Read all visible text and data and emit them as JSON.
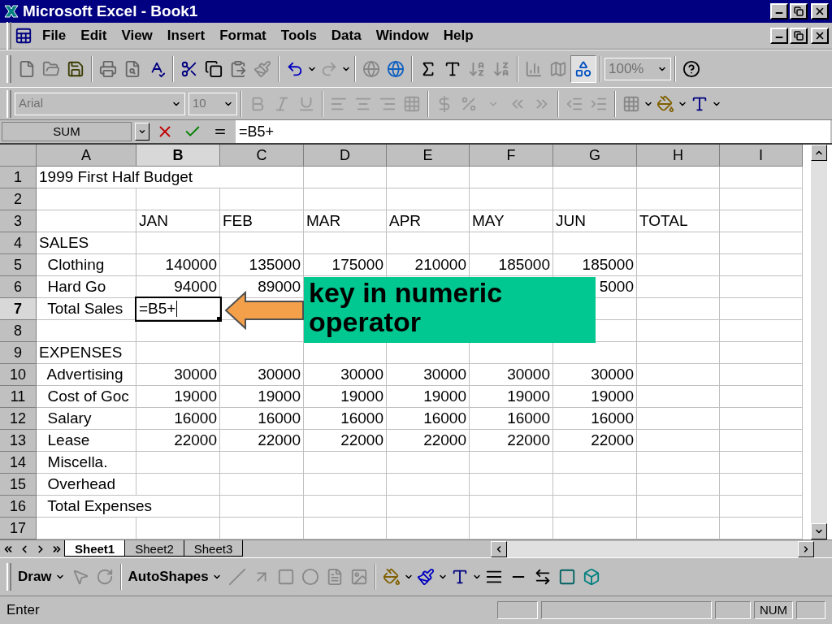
{
  "window": {
    "title": "Microsoft Excel - Book1"
  },
  "menu": [
    "File",
    "Edit",
    "View",
    "Insert",
    "Format",
    "Tools",
    "Data",
    "Window",
    "Help"
  ],
  "standard_toolbar": {
    "zoom": "100%"
  },
  "formatting_toolbar": {
    "font": "Arial",
    "size": "10"
  },
  "formula_bar": {
    "name_box": "SUM",
    "formula": "=B5+"
  },
  "columns": [
    {
      "label": "A",
      "selected": false
    },
    {
      "label": "B",
      "selected": true
    },
    {
      "label": "C",
      "selected": false
    },
    {
      "label": "D",
      "selected": false
    },
    {
      "label": "E",
      "selected": false
    },
    {
      "label": "F",
      "selected": false
    },
    {
      "label": "G",
      "selected": false
    },
    {
      "label": "H",
      "selected": false
    },
    {
      "label": "I",
      "selected": false
    }
  ],
  "rows": [
    {
      "label": "1",
      "selected": false,
      "cells": [
        "1999 First Half Budget",
        "",
        "",
        "",
        "",
        "",
        "",
        "",
        ""
      ]
    },
    {
      "label": "2",
      "selected": false,
      "cells": [
        "",
        "",
        "",
        "",
        "",
        "",
        "",
        "",
        ""
      ]
    },
    {
      "label": "3",
      "selected": false,
      "cells": [
        "",
        "JAN",
        "FEB",
        "MAR",
        "APR",
        "MAY",
        "JUN",
        "TOTAL",
        ""
      ]
    },
    {
      "label": "4",
      "selected": false,
      "cells": [
        "SALES",
        "",
        "",
        "",
        "",
        "",
        "",
        "",
        ""
      ]
    },
    {
      "label": "5",
      "selected": false,
      "cells": [
        "  Clothing",
        "140000",
        "135000",
        "175000",
        "210000",
        "185000",
        "185000",
        "",
        ""
      ]
    },
    {
      "label": "6",
      "selected": false,
      "cells": [
        "  Hard Go",
        "94000",
        "89000",
        "",
        "",
        "",
        "5000",
        "",
        ""
      ]
    },
    {
      "label": "7",
      "selected": true,
      "cells": [
        "  Total Sales",
        "=B5+",
        "",
        "",
        "",
        "",
        "",
        "",
        ""
      ]
    },
    {
      "label": "8",
      "selected": false,
      "cells": [
        "",
        "",
        "",
        "",
        "",
        "",
        "",
        "",
        ""
      ]
    },
    {
      "label": "9",
      "selected": false,
      "cells": [
        "EXPENSES",
        "",
        "",
        "",
        "",
        "",
        "",
        "",
        ""
      ]
    },
    {
      "label": "10",
      "selected": false,
      "cells": [
        "  Advertising",
        "30000",
        "30000",
        "30000",
        "30000",
        "30000",
        "30000",
        "",
        ""
      ]
    },
    {
      "label": "11",
      "selected": false,
      "cells": [
        "  Cost of Goc",
        "19000",
        "19000",
        "19000",
        "19000",
        "19000",
        "19000",
        "",
        ""
      ]
    },
    {
      "label": "12",
      "selected": false,
      "cells": [
        "  Salary",
        "16000",
        "16000",
        "16000",
        "16000",
        "16000",
        "16000",
        "",
        ""
      ]
    },
    {
      "label": "13",
      "selected": false,
      "cells": [
        "  Lease",
        "22000",
        "22000",
        "22000",
        "22000",
        "22000",
        "22000",
        "",
        ""
      ]
    },
    {
      "label": "14",
      "selected": false,
      "cells": [
        "  Miscella.",
        "",
        "",
        "",
        "",
        "",
        "",
        "",
        ""
      ]
    },
    {
      "label": "15",
      "selected": false,
      "cells": [
        "  Overhead",
        "",
        "",
        "",
        "",
        "",
        "",
        "",
        ""
      ]
    },
    {
      "label": "16",
      "selected": false,
      "cells": [
        "  Total Expenses",
        "",
        "",
        "",
        "",
        "",
        "",
        "",
        ""
      ]
    },
    {
      "label": "17",
      "selected": false,
      "cells": [
        "",
        "",
        "",
        "",
        "",
        "",
        "",
        "",
        ""
      ]
    }
  ],
  "callout": {
    "text": "key in numeric operator"
  },
  "sheet_tabs": [
    {
      "label": "Sheet1",
      "selected": true
    },
    {
      "label": "Sheet2",
      "selected": false
    },
    {
      "label": "Sheet3",
      "selected": false
    }
  ],
  "drawing_toolbar": {
    "draw": "Draw",
    "autoshapes": "AutoShapes"
  },
  "status_bar": {
    "mode": "Enter",
    "num": "NUM"
  }
}
